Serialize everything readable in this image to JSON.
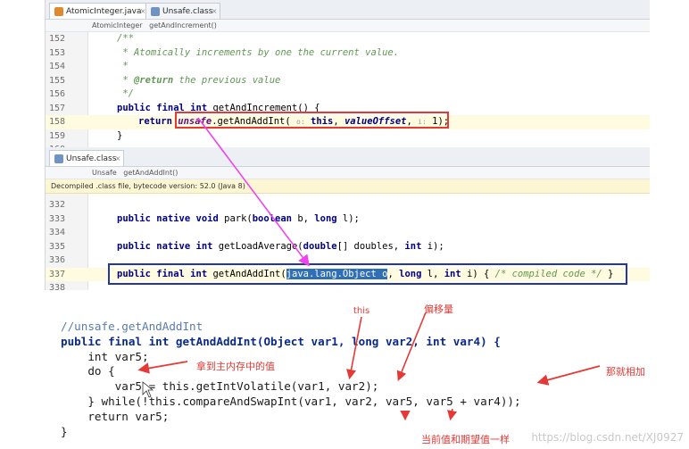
{
  "top_pane": {
    "tabs": [
      {
        "label": "AtomicInteger.java",
        "icon": "java-file-icon"
      },
      {
        "label": "Unsafe.class",
        "icon": "class-file-icon"
      }
    ],
    "breadcrumb": [
      "AtomicInteger",
      "getAndIncrement()"
    ],
    "lines": [
      {
        "num": "152",
        "text": "/**"
      },
      {
        "num": "153",
        "text": " * Atomically increments by one the current value."
      },
      {
        "num": "154",
        "text": " *"
      },
      {
        "num": "155",
        "tag": "@return",
        "text": " the previous value"
      },
      {
        "num": "156",
        "text": " */"
      },
      {
        "num": "157",
        "k1": "public final int",
        "text": " getAndIncrement() {"
      },
      {
        "num": "158",
        "k1": "return",
        "field": "unsafe",
        "call": ".getAndAddInt(",
        "h1": "o:",
        "kthis": "this",
        "comma1": ",",
        "arg2": "valueOffset",
        "comma2": ",",
        "h2": "i:",
        "tail": "1);"
      },
      {
        "num": "159",
        "text": "}"
      },
      {
        "num": "160",
        "text": ""
      }
    ]
  },
  "bottom_pane": {
    "tab": {
      "label": "Unsafe.class",
      "icon": "class-file-icon"
    },
    "breadcrumb": [
      "Unsafe",
      "getAndAddInt()"
    ],
    "notice": "Decompiled .class file, bytecode version: 52.0 (Java 8)",
    "lines": [
      {
        "num": "332",
        "text": ""
      },
      {
        "num": "333",
        "k1": "public native void",
        "text": " park(",
        "k2": "boolean",
        "text2": " b, ",
        "k3": "long",
        "text3": " l);"
      },
      {
        "num": "334",
        "text": ""
      },
      {
        "num": "335",
        "k1": "public native int",
        "text": " getLoadAverage(",
        "k2": "double",
        "text2": "[] doubles, ",
        "k3": "int",
        "text3": " i);"
      },
      {
        "num": "336",
        "text": ""
      },
      {
        "num": "337",
        "k1": "public final int",
        "text": " getAndAddInt(",
        "sel": "java.lang.Object o",
        "text2": ", ",
        "k2": "long",
        "text3": " l, ",
        "k3": "int",
        "text4": " i) { ",
        "cm": "/* compiled code */",
        "tail": " }"
      },
      {
        "num": "338",
        "text": ""
      }
    ]
  },
  "snippet": {
    "lines": [
      "//unsafe.getAndAddInt",
      "public final int getAndAddInt(Object var1, long var2, int var4) {",
      "    int var5;",
      "    do {",
      "        var5 = this.getIntVolatile(var1, var2);",
      "    } while(!this.compareAndSwapInt(var1, var2, var5, var5 + var4));",
      "    return var5;",
      "}"
    ]
  },
  "notes": {
    "this": "this",
    "offset": "偏移量",
    "read_main": "拿到主内存中的值",
    "add": "那就相加",
    "compare": "当前值和期望值一样"
  },
  "watermark": "https://blog.csdn.net/XJ0927",
  "colors": {
    "annotation_red": "#e53935",
    "annotation_blue": "#2336a8",
    "arrow_magenta": "#ee44ee",
    "selection": "#2f6fb8"
  }
}
